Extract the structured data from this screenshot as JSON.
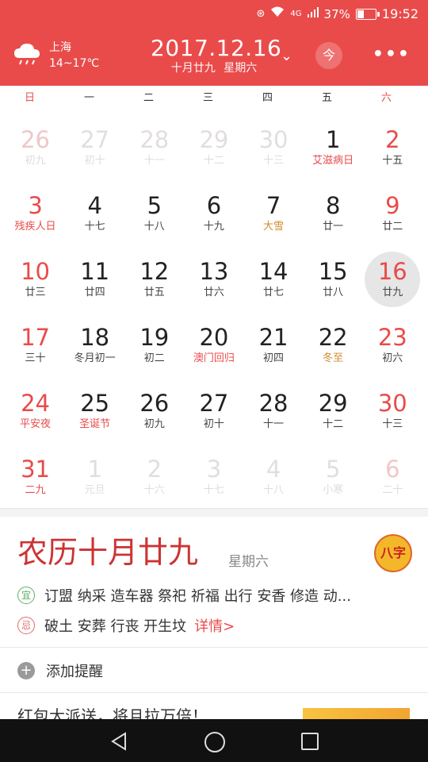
{
  "status_bar": {
    "time": "19:52",
    "battery_percent": "37%",
    "battery_level": 0.37,
    "network": "4G",
    "signal": "4G"
  },
  "header": {
    "city": "上海",
    "temp": "14~17℃",
    "date": "2017.12.16",
    "lunar_date": "十月廿九",
    "weekday": "星期六",
    "today_label": "今",
    "more_label": "•••",
    "weather_icon": "cloud-rain-icon"
  },
  "weekdays": [
    "日",
    "一",
    "二",
    "三",
    "四",
    "五",
    "六"
  ],
  "calendar": [
    [
      {
        "d": "26",
        "l": "初九",
        "dim": true
      },
      {
        "d": "27",
        "l": "初十",
        "dim": true
      },
      {
        "d": "28",
        "l": "十一",
        "dim": true
      },
      {
        "d": "29",
        "l": "十二",
        "dim": true
      },
      {
        "d": "30",
        "l": "十三",
        "dim": true
      },
      {
        "d": "1",
        "l": "艾滋病日",
        "type": "festival"
      },
      {
        "d": "2",
        "l": "十五"
      }
    ],
    [
      {
        "d": "3",
        "l": "残疾人日",
        "type": "festival"
      },
      {
        "d": "4",
        "l": "十七"
      },
      {
        "d": "5",
        "l": "十八"
      },
      {
        "d": "6",
        "l": "十九"
      },
      {
        "d": "7",
        "l": "大雪",
        "type": "term"
      },
      {
        "d": "8",
        "l": "廿一"
      },
      {
        "d": "9",
        "l": "廿二"
      }
    ],
    [
      {
        "d": "10",
        "l": "廿三"
      },
      {
        "d": "11",
        "l": "廿四"
      },
      {
        "d": "12",
        "l": "廿五"
      },
      {
        "d": "13",
        "l": "廿六"
      },
      {
        "d": "14",
        "l": "廿七"
      },
      {
        "d": "15",
        "l": "廿八"
      },
      {
        "d": "16",
        "l": "廿九",
        "selected": true
      }
    ],
    [
      {
        "d": "17",
        "l": "三十"
      },
      {
        "d": "18",
        "l": "冬月初一"
      },
      {
        "d": "19",
        "l": "初二"
      },
      {
        "d": "20",
        "l": "澳门回归",
        "type": "festival"
      },
      {
        "d": "21",
        "l": "初四"
      },
      {
        "d": "22",
        "l": "冬至",
        "type": "term"
      },
      {
        "d": "23",
        "l": "初六"
      }
    ],
    [
      {
        "d": "24",
        "l": "平安夜",
        "type": "festival"
      },
      {
        "d": "25",
        "l": "圣诞节",
        "type": "festival"
      },
      {
        "d": "26",
        "l": "初九"
      },
      {
        "d": "27",
        "l": "初十"
      },
      {
        "d": "28",
        "l": "十一"
      },
      {
        "d": "29",
        "l": "十二"
      },
      {
        "d": "30",
        "l": "十三"
      }
    ],
    [
      {
        "d": "31",
        "l": "二九",
        "type": "festival"
      },
      {
        "d": "1",
        "l": "元旦",
        "dim": true
      },
      {
        "d": "2",
        "l": "十六",
        "dim": true
      },
      {
        "d": "3",
        "l": "十七",
        "dim": true
      },
      {
        "d": "4",
        "l": "十八",
        "dim": true
      },
      {
        "d": "5",
        "l": "小寒",
        "dim": true
      },
      {
        "d": "6",
        "l": "二十",
        "dim": true
      }
    ]
  ],
  "detail": {
    "title": "农历十月廿九",
    "weekday": "星期六",
    "bazi_label": "八字",
    "yi_badge": "宜",
    "yi_text": "订盟 纳采 造车器 祭祀 祈福 出行 安香 修造 动...",
    "ji_badge": "忌",
    "ji_text": "破土 安葬 行丧 开生坟",
    "details_link": "详情>"
  },
  "reminder": {
    "label": "添加提醒"
  },
  "promo": {
    "text": "红包大派送，将且拉万倍！"
  }
}
